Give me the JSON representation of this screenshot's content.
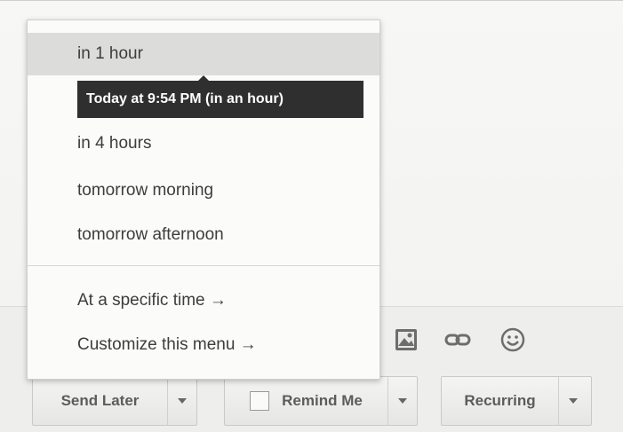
{
  "snooze_menu": {
    "items": [
      {
        "label": "in 1 hour"
      },
      {
        "label": "in 4 hours"
      },
      {
        "label": "tomorrow morning"
      },
      {
        "label": "tomorrow afternoon"
      }
    ],
    "specific_time": "At a specific time →",
    "customize": "Customize this menu →",
    "tooltip": "Today at 9:54 PM (in an hour)"
  },
  "toolbar": {
    "icons": [
      "image-icon",
      "link-icon",
      "emoji-icon"
    ],
    "send_later_label": "Send Later",
    "remind_me_label": "Remind Me",
    "recurring_label": "Recurring"
  },
  "colors": {
    "tooltip_bg": "#2f2f2f",
    "highlight_bg": "#dcdcda"
  }
}
